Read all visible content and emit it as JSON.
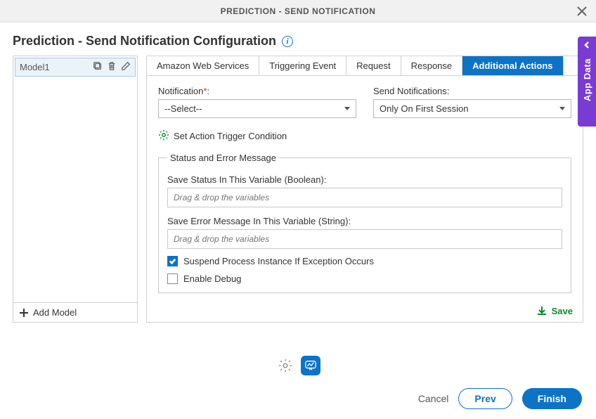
{
  "titlebar": {
    "title": "PREDICTION - SEND NOTIFICATION"
  },
  "header": {
    "title": "Prediction - Send Notification Configuration"
  },
  "sidebar": {
    "items": [
      {
        "label": "Model1"
      }
    ],
    "add_label": "Add Model"
  },
  "tabs": [
    {
      "label": "Amazon Web Services",
      "active": false
    },
    {
      "label": "Triggering Event",
      "active": false
    },
    {
      "label": "Request",
      "active": false
    },
    {
      "label": "Response",
      "active": false
    },
    {
      "label": "Additional Actions",
      "active": true
    }
  ],
  "form": {
    "notification_label": "Notification",
    "notification_required": "*",
    "notification_colon": ":",
    "notification_value": "--Select--",
    "send_notif_label": "Send Notifications:",
    "send_notif_value": "Only On First Session",
    "trigger_label": "Set Action Trigger Condition",
    "fieldset_legend": "Status and Error Message",
    "status_var_label": "Save Status In This Variable (Boolean):",
    "status_var_placeholder": "Drag & drop the variables",
    "error_var_label": "Save Error Message In This Variable (String):",
    "error_var_placeholder": "Drag & drop the variables",
    "suspend_label": "Suspend Process Instance If Exception Occurs",
    "debug_label": "Enable Debug",
    "save_label": "Save"
  },
  "footer": {
    "cancel": "Cancel",
    "prev": "Prev",
    "finish": "Finish"
  },
  "sidepanel": {
    "label": "App Data"
  }
}
